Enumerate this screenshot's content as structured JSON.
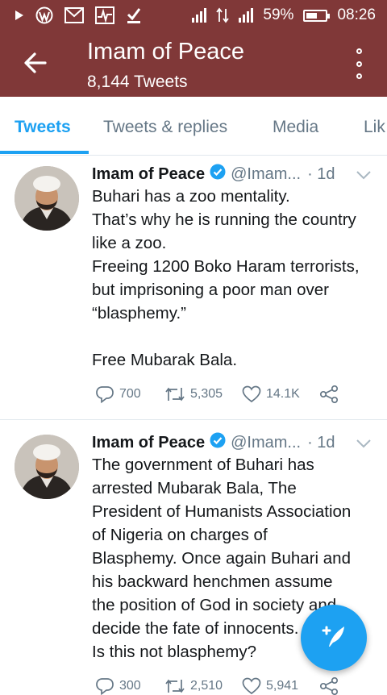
{
  "status_bar": {
    "battery_percent": "59%",
    "battery_level": 0.59,
    "time": "08:26"
  },
  "app_bar": {
    "title": "Imam of Peace",
    "subtitle": "8,144 Tweets"
  },
  "tabs": [
    {
      "label": "Tweets",
      "active": true
    },
    {
      "label": "Tweets & replies",
      "active": false
    },
    {
      "label": "Media",
      "active": false
    },
    {
      "label": "Lik",
      "active": false
    }
  ],
  "tweets": [
    {
      "name": "Imam of Peace",
      "handle": "@Imam...",
      "separator": "·",
      "time": "1d",
      "lines": [
        "Buhari has a zoo mentality.",
        "That’s why he is running the country",
        "like a zoo.",
        "Freeing 1200 Boko Haram terrorists,",
        "but imprisoning a poor man over",
        "“blasphemy.”",
        "",
        "Free Mubarak Bala."
      ],
      "replies": "700",
      "retweets": "5,305",
      "likes": "14.1K"
    },
    {
      "name": "Imam of Peace",
      "handle": "@Imam...",
      "separator": "·",
      "time": "1d",
      "lines": [
        "The government of Buhari has",
        "arrested Mubarak Bala, The",
        "President of Humanists Association",
        "of Nigeria on charges of",
        "Blasphemy. Once again Buhari and",
        "his backward henchmen assume",
        "the position of God in society and",
        "decide the fate of innocents.",
        "Is this not blasphemy?"
      ],
      "replies": "300",
      "retweets": "2,510",
      "likes": "5,941"
    }
  ],
  "colors": {
    "header_bg": "#803838",
    "accent": "#1da1f2",
    "secondary_text": "#657786"
  },
  "icons": {
    "back": "back-arrow-icon",
    "more": "more-vertical-icon",
    "compose": "compose-tweet-icon"
  }
}
